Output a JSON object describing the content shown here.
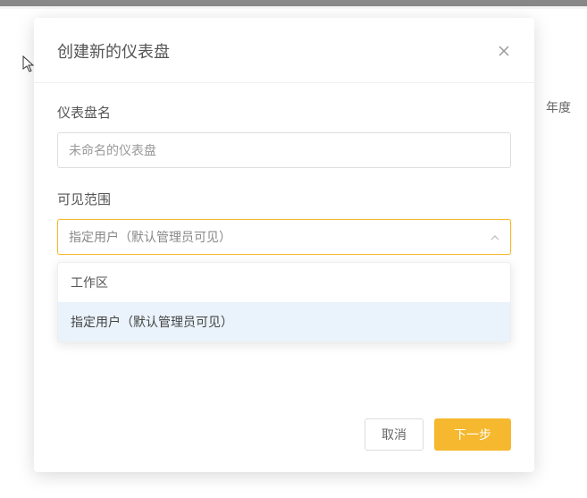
{
  "background": {
    "year_label": "年度"
  },
  "modal": {
    "title": "创建新的仪表盘",
    "name_label": "仪表盘名",
    "name_value": "未命名的仪表盘",
    "scope_label": "可见范围",
    "scope_value": "指定用户（默认管理员可见）",
    "dropdown_options": {
      "workspace": "工作区",
      "specified": "指定用户（默认管理员可见）"
    },
    "cancel_button": "取消",
    "next_button": "下一步"
  },
  "colors": {
    "accent": "#f5b82e"
  }
}
